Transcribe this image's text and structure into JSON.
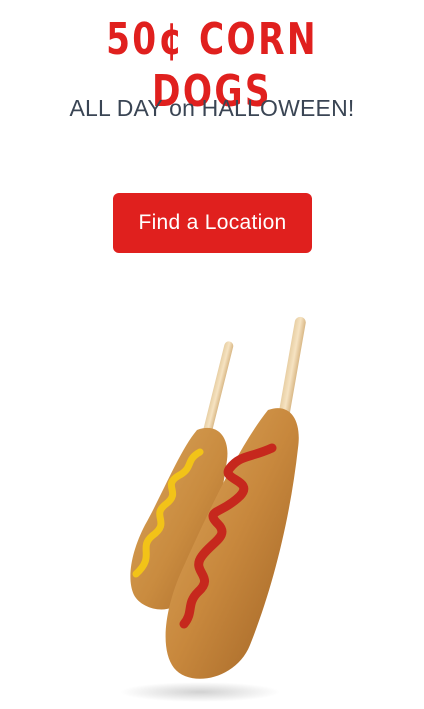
{
  "promo": {
    "headline": "50¢ CORN DOGS",
    "subhead": "ALL DAY on HALLOWEEN!",
    "cta_label": "Find a Location"
  },
  "colors": {
    "brand_red": "#e0201e",
    "text_dark": "#3a4554",
    "button_text": "#ffffff"
  },
  "icons": {
    "product_image": "corn-dogs-image"
  }
}
